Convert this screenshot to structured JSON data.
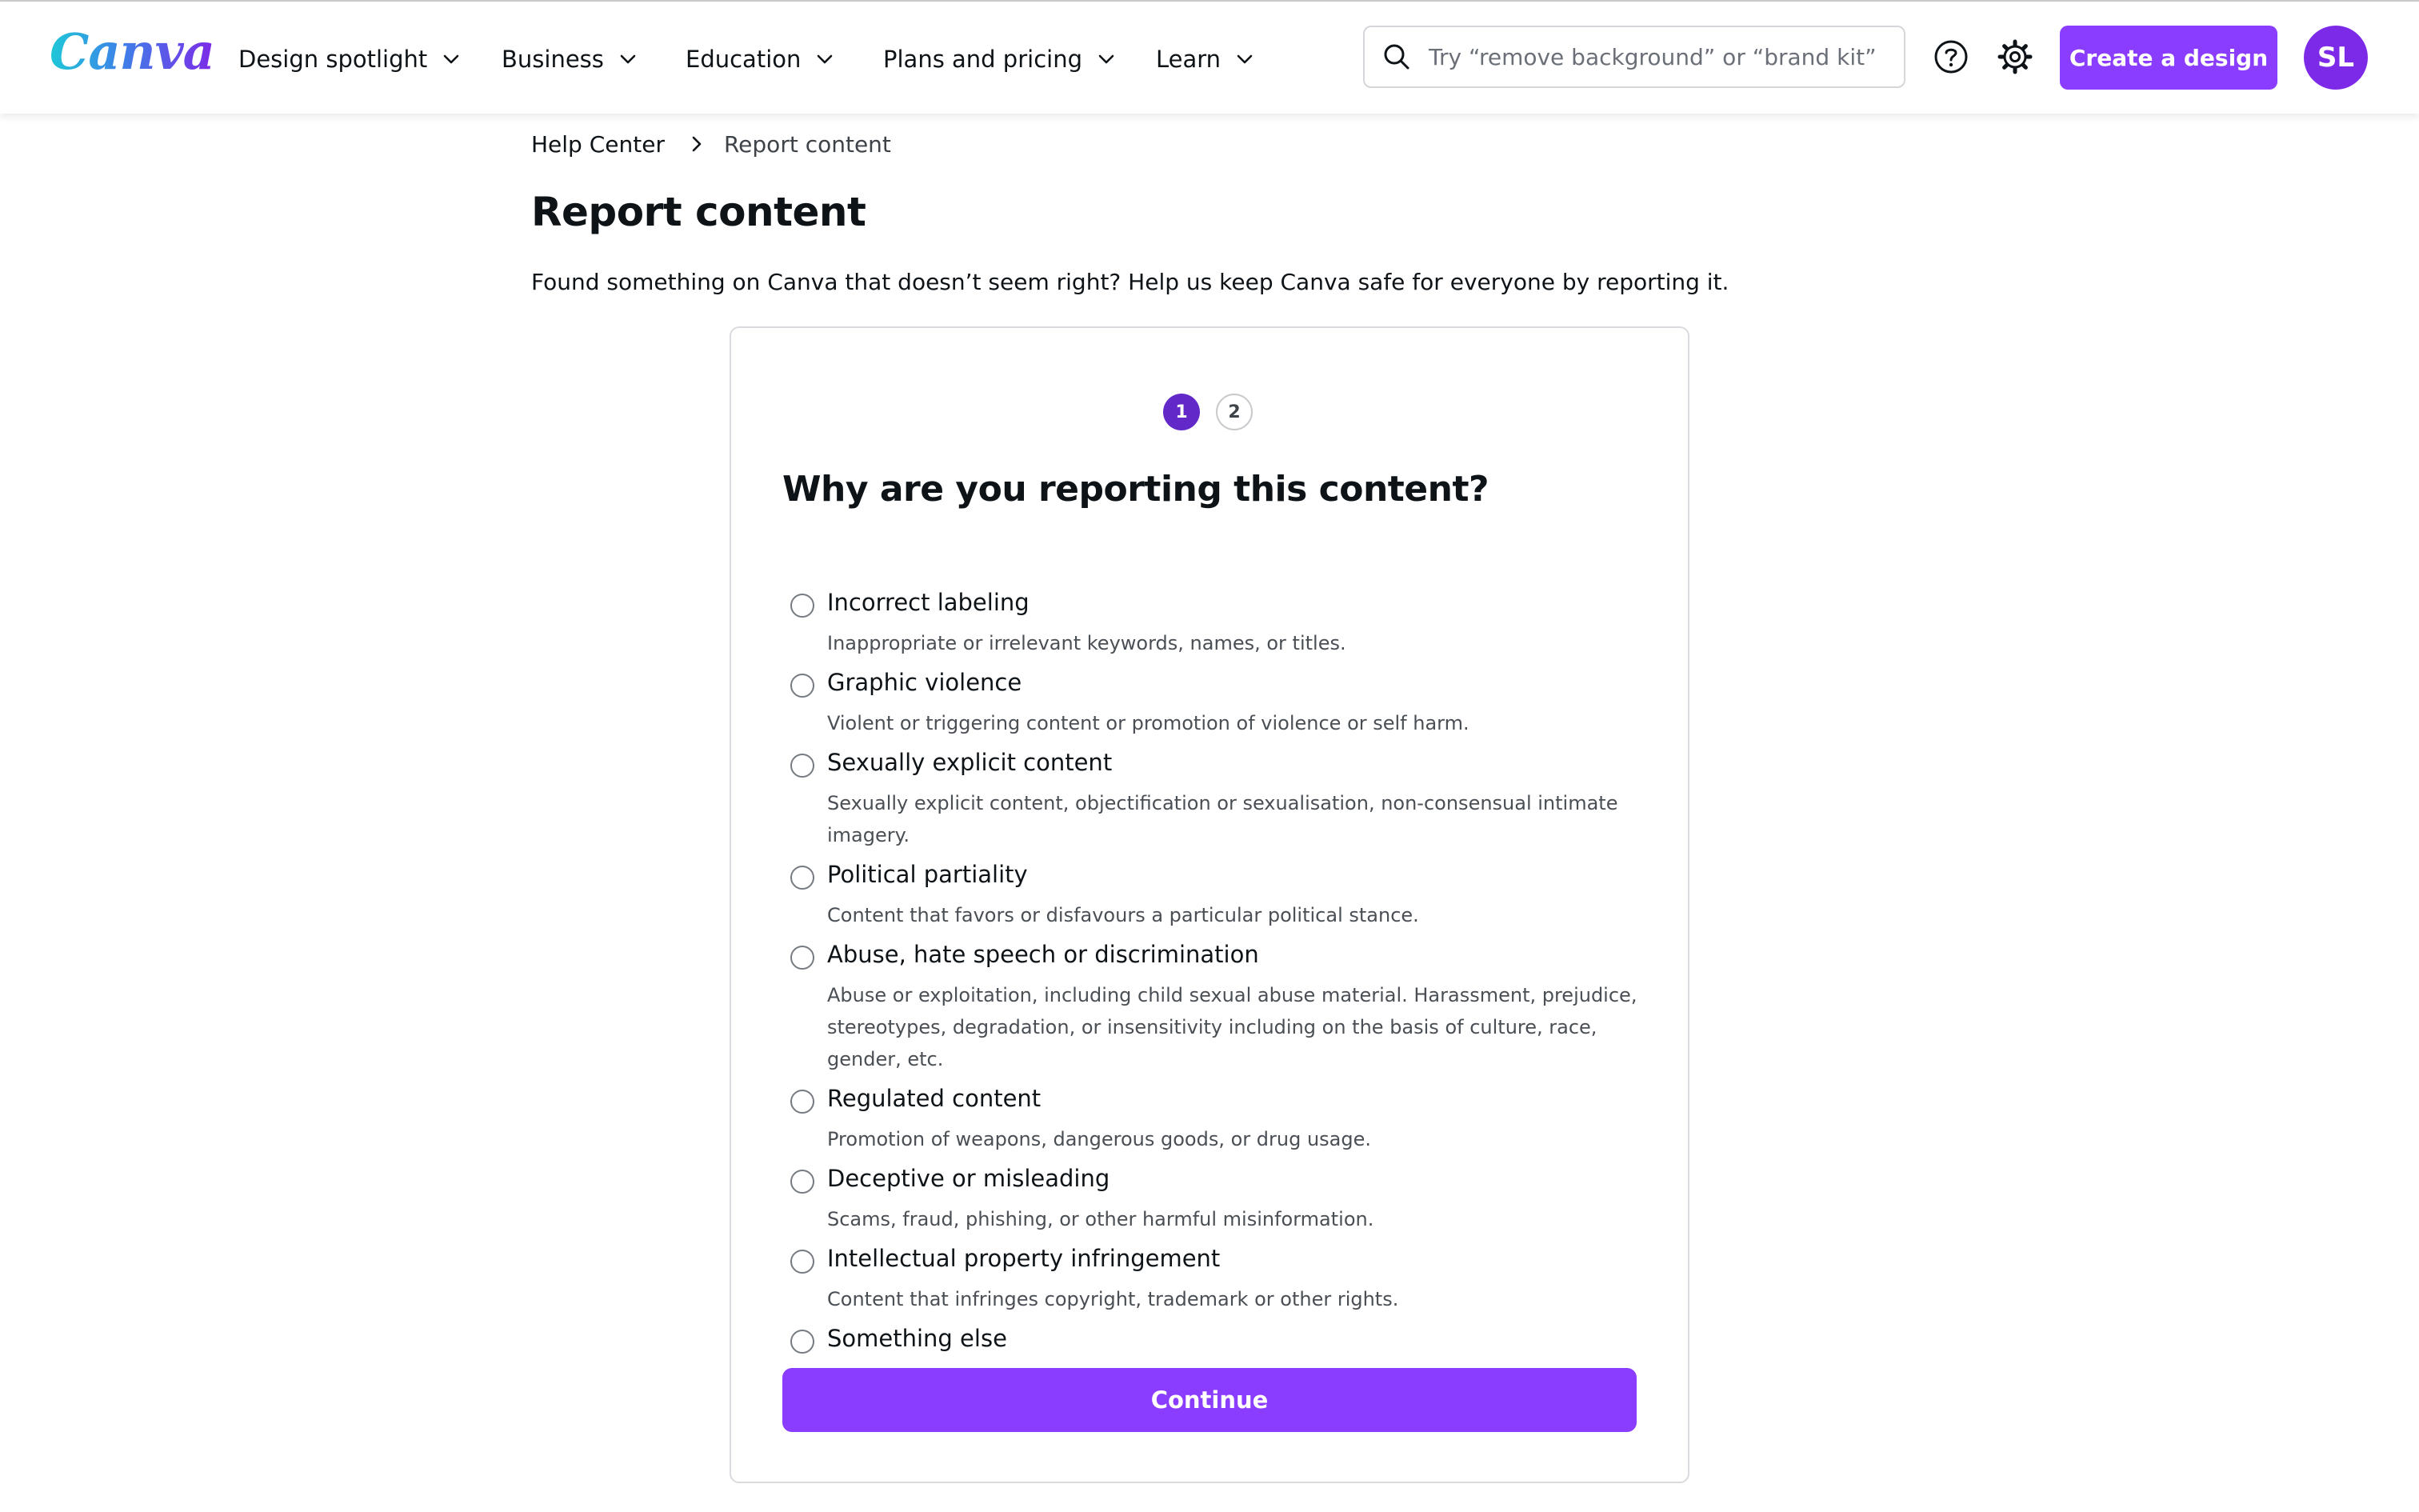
{
  "header": {
    "logo": "Canva",
    "nav": [
      {
        "label": "Design spotlight"
      },
      {
        "label": "Business"
      },
      {
        "label": "Education"
      },
      {
        "label": "Plans and pricing"
      },
      {
        "label": "Learn"
      }
    ],
    "search": {
      "placeholder": "Try “remove background” or “brand kit”",
      "icon": "search-icon"
    },
    "help_icon": "help-circle-icon",
    "settings_icon": "gear-icon",
    "create_label": "Create a design",
    "avatar_initials": "SL"
  },
  "breadcrumb": {
    "home": "Help Center",
    "current": "Report content"
  },
  "page": {
    "title": "Report content",
    "intro": "Found something on Canva that doesn’t seem right? Help us keep Canva safe for everyone by reporting it."
  },
  "form": {
    "steps": [
      {
        "label": "1",
        "active": true
      },
      {
        "label": "2",
        "active": false
      }
    ],
    "question": "Why are you reporting this content?",
    "options": [
      {
        "label": "Incorrect labeling",
        "description": "Inappropriate or irrelevant keywords, names, or titles."
      },
      {
        "label": "Graphic violence",
        "description": "Violent or triggering content or promotion of violence or self harm."
      },
      {
        "label": "Sexually explicit content",
        "description": "Sexually explicit content, objectification or sexualisation, non-consensual intimate imagery."
      },
      {
        "label": "Political partiality",
        "description": "Content that favors or disfavours a particular political stance."
      },
      {
        "label": "Abuse, hate speech or discrimination",
        "description": "Abuse or exploitation, including child sexual abuse material. Harassment, prejudice, stereotypes, degradation, or insensitivity including on the basis of culture, race, gender, etc."
      },
      {
        "label": "Regulated content",
        "description": "Promotion of weapons, dangerous goods, or drug usage."
      },
      {
        "label": "Deceptive or misleading",
        "description": "Scams, fraud, phishing, or other harmful misinformation."
      },
      {
        "label": "Intellectual property infringement",
        "description": "Content that infringes copyright, trademark or other rights."
      },
      {
        "label": "Something else",
        "description": ""
      }
    ],
    "continue_label": "Continue"
  },
  "colors": {
    "accent": "#8b3dff",
    "step_active": "#6229c8",
    "avatar": "#7d2ae8"
  }
}
